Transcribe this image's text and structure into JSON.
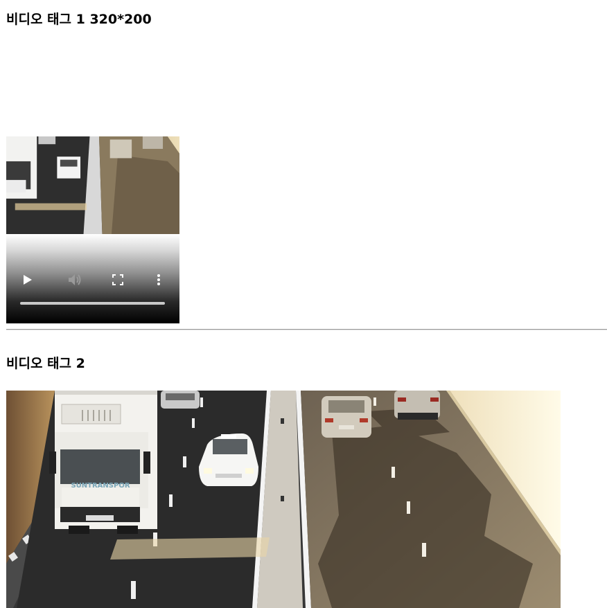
{
  "heading1": "비디오 태그 1 320*200",
  "heading2": "비디오 태그 2",
  "video1": {
    "controls": {
      "play_icon": "play-icon",
      "mute_icon": "volume-icon",
      "fullscreen_icon": "fullscreen-icon",
      "menu_icon": "more-vert-icon"
    },
    "progress_fraction": 0.0
  },
  "video2": {
    "logo_text": "SUNTRANSPOR"
  }
}
